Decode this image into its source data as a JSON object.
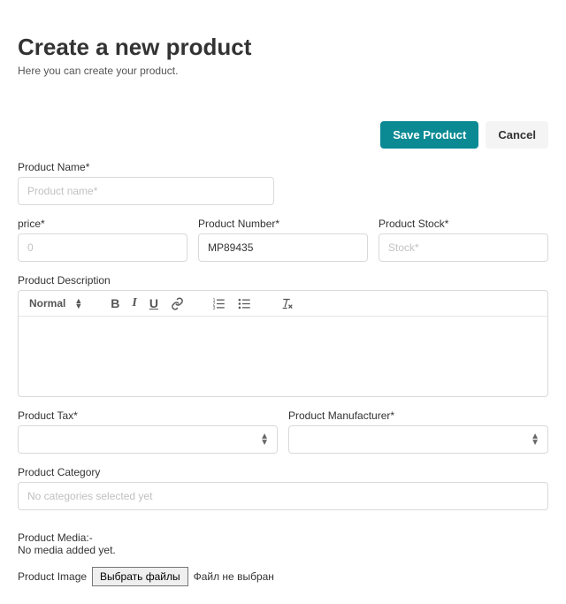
{
  "header": {
    "title": "Create a new product",
    "subtitle": "Here you can create your product."
  },
  "actions": {
    "save": "Save Product",
    "cancel": "Cancel"
  },
  "fields": {
    "name": {
      "label": "Product Name*",
      "placeholder": "Product name*",
      "value": ""
    },
    "price": {
      "label": "price*",
      "placeholder": "0",
      "value": ""
    },
    "number": {
      "label": "Product Number*",
      "placeholder": "",
      "value": "MP89435"
    },
    "stock": {
      "label": "Product Stock*",
      "placeholder": "Stock*",
      "value": ""
    },
    "description": {
      "label": "Product Description"
    },
    "tax": {
      "label": "Product Tax*",
      "value": ""
    },
    "manufacturer": {
      "label": "Product Manufacturer*",
      "value": ""
    },
    "category": {
      "label": "Product Category",
      "placeholder": "No categories selected yet"
    }
  },
  "editor": {
    "format_label": "Normal"
  },
  "media": {
    "heading": "Product Media:-",
    "empty": "No media added yet.",
    "image_label": "Product Image",
    "choose_files": "Выбрать файлы",
    "no_file": "Файл не выбран"
  }
}
